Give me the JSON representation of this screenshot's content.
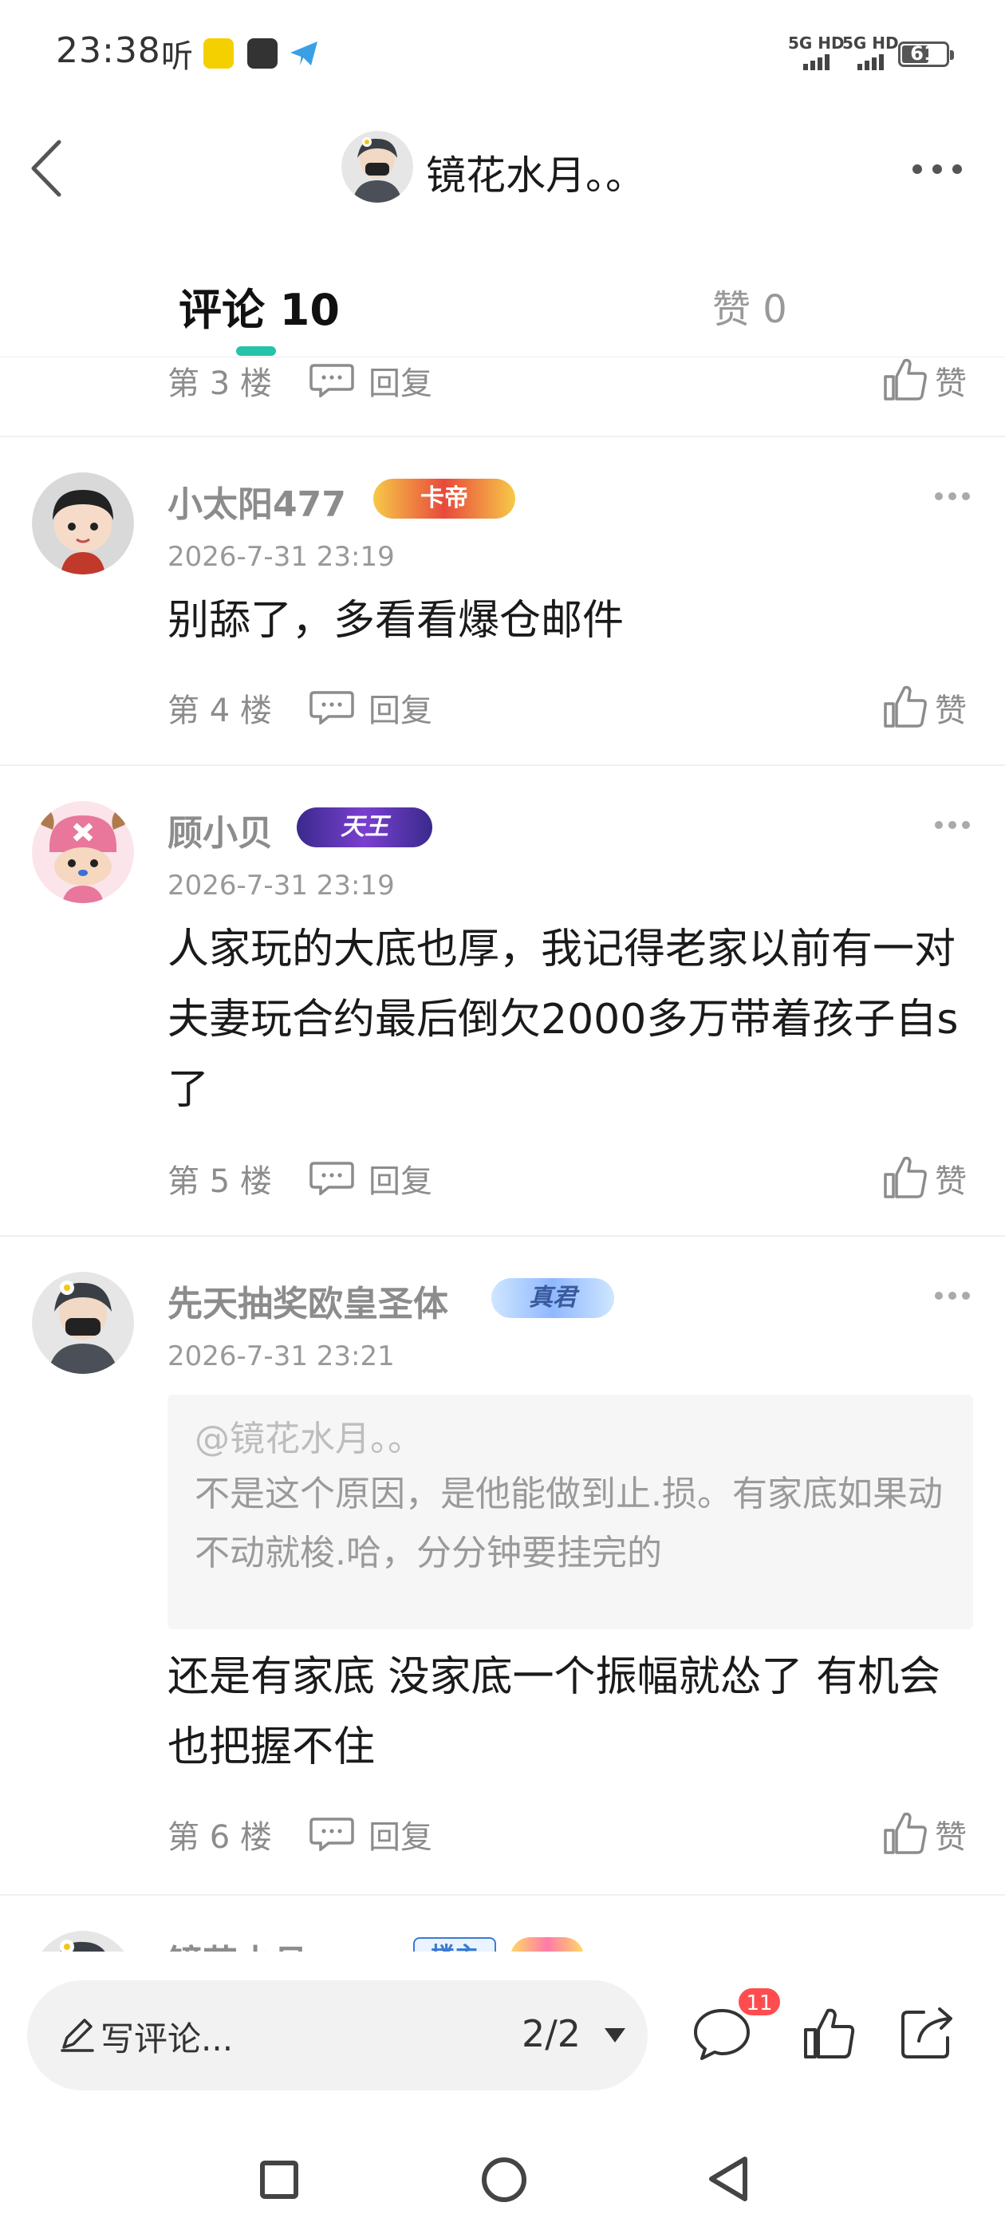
{
  "status_bar": {
    "time": "23:38",
    "listen_label": "听",
    "network_1": "5G HD",
    "network_2": "5G HD",
    "battery": "61",
    "battery_level": 0.61
  },
  "header": {
    "title": "镜花水月。。",
    "back_icon": "chevron-left-icon",
    "more_icon": "more-horizontal-icon"
  },
  "tabs": {
    "comments": "评论 10",
    "likes": "赞 0",
    "active": "comments",
    "accent_color": "#25c4a8"
  },
  "common": {
    "reply_label": "回复",
    "like_label": "赞"
  },
  "comments": [
    {
      "floor": "第 3 楼"
    },
    {
      "username": "小太阳477",
      "badge": "卡帝",
      "time": "2026-7-31 23:19",
      "text": "别舔了，多看看爆仓邮件",
      "floor": "第 4 楼"
    },
    {
      "username": "顾小贝",
      "badge": "天王",
      "time": "2026-7-31 23:19",
      "text": "人家玩的大底也厚，我记得老家以前有一对夫妻玩合约最后倒欠2000多万带着孩子自s了",
      "floor": "第 5 楼"
    },
    {
      "username": "先天抽奖欧皇圣体",
      "badge": "真君",
      "time": "2026-7-31 23:21",
      "quote_at": "@镜花水月。。",
      "quote_text": "不是这个原因，是他能做到止.损。有家底如果动不动就梭.哈，分分钟要挂完的",
      "text": "还是有家底 没家底一个振幅就怂了 有机会也把握不住",
      "floor": "第 6 楼"
    },
    {
      "username": "镜花水月",
      "badge": "楼主"
    }
  ],
  "bottom_bar": {
    "input_placeholder": "写评论...",
    "page_indicator": "2/2",
    "comment_count": "11",
    "badge_color": "#ff4d4f"
  }
}
